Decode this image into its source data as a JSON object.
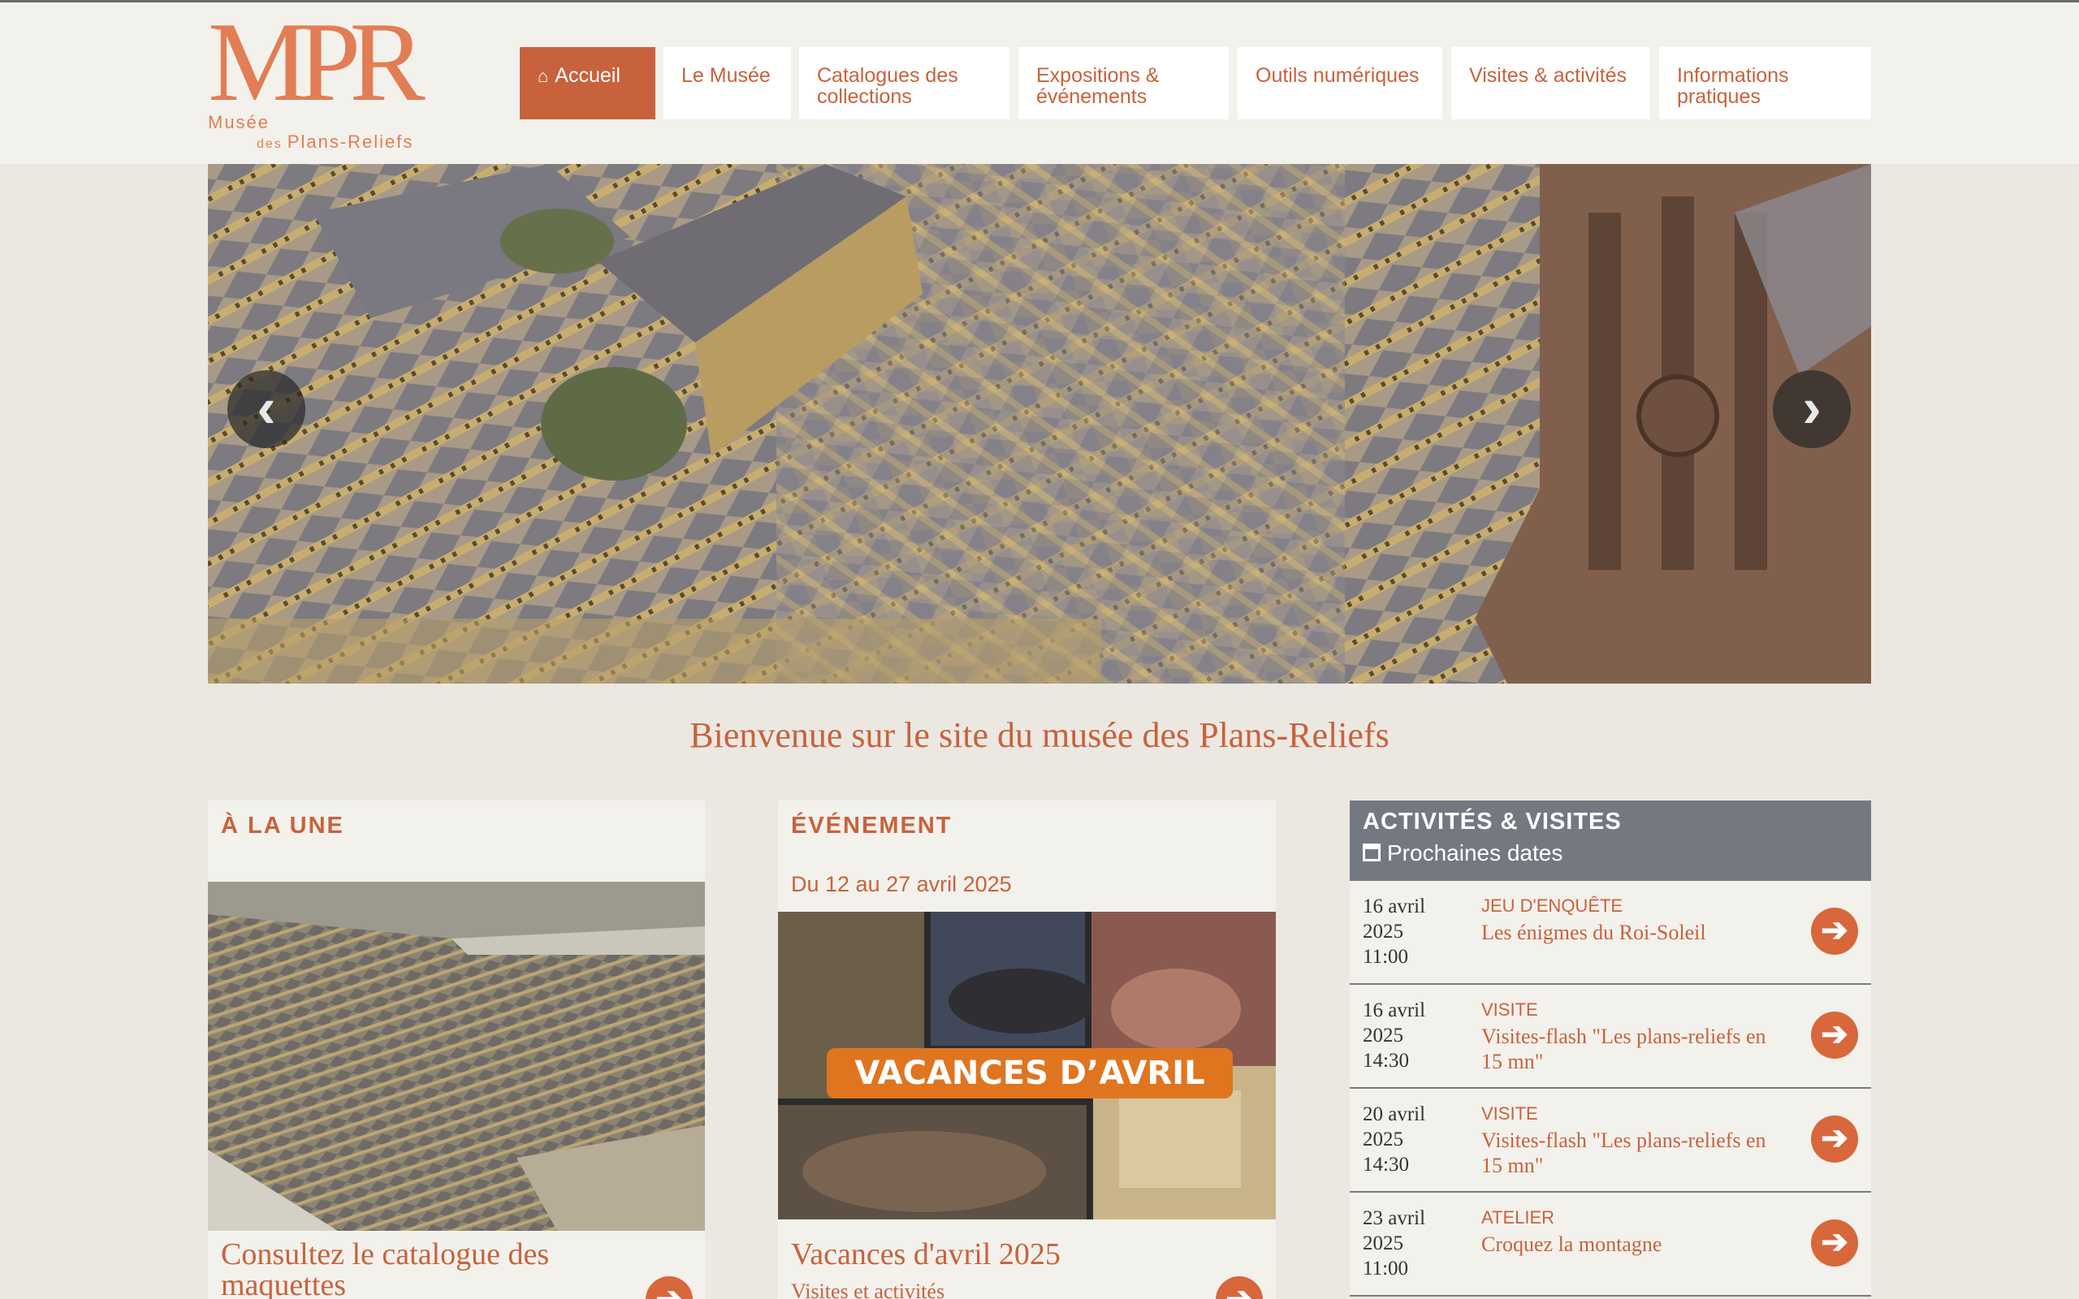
{
  "logo": {
    "mark": "MPR",
    "line1": "Musée",
    "line2_small": "des",
    "line2": "Plans-Reliefs"
  },
  "nav": {
    "items": [
      {
        "label": "Accueil",
        "icon": "home-icon",
        "active": true
      },
      {
        "label": "Le Musée"
      },
      {
        "label": "Catalogues des collections"
      },
      {
        "label": "Expositions & événements"
      },
      {
        "label": "Outils numériques"
      },
      {
        "label": "Visites & activités"
      },
      {
        "label": "Informations pratiques"
      }
    ]
  },
  "hero": {
    "prev_icon": "chevron-left-icon",
    "next_icon": "chevron-right-icon",
    "prev_glyph": "‹",
    "next_glyph": "›"
  },
  "welcome": "Bienvenue sur le site du musée des Plans-Reliefs",
  "a_la_une": {
    "title": "À LA UNE",
    "heading": "Consultez le catalogue des maquettes"
  },
  "evenement": {
    "title": "ÉVÉNEMENT",
    "date": "Du 12 au 27 avril 2025",
    "banner": "VACANCES D’AVRIL",
    "heading": "Vacances d'avril 2025",
    "sub": "Visites et activités"
  },
  "agenda": {
    "title": "ACTIVITÉS & VISITES",
    "subtitle": "Prochaines dates",
    "rows": [
      {
        "day": "16 avril",
        "year": "2025",
        "time": "11:00",
        "type": "JEU D'ENQUÊTE",
        "title": "Les énigmes du Roi-Soleil"
      },
      {
        "day": "16 avril",
        "year": "2025",
        "time": "14:30",
        "type": "VISITE",
        "title": "Visites-flash \"Les plans-reliefs en 15 mn\""
      },
      {
        "day": "20 avril",
        "year": "2025",
        "time": "14:30",
        "type": "VISITE",
        "title": "Visites-flash \"Les plans-reliefs en 15 mn\""
      },
      {
        "day": "23 avril",
        "year": "2025",
        "time": "11:00",
        "type": "ATELIER",
        "title": "Croquez la montagne"
      }
    ]
  },
  "go_glyph": "➔",
  "colors": {
    "accent": "#c8623c",
    "header_bg": "#f3f1ec",
    "agenda_head": "#747880"
  }
}
